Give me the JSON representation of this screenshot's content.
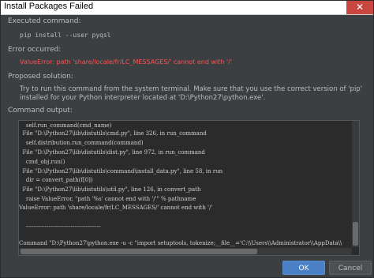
{
  "window": {
    "title": "Install Packages Failed",
    "close_glyph": "✕"
  },
  "executed": {
    "label": "Executed command:",
    "command": "pip install --user pyqsl"
  },
  "error": {
    "label": "Error occurred:",
    "message": "ValueError: path 'share/locale/fr/LC_MESSAGES/' cannot end with '/'"
  },
  "solution": {
    "label": "Proposed solution:",
    "text": "Try to run this command from the system terminal. Make sure that you use the correct version of 'pip' installed for your Python interpreter located at 'D:\\Python27\\python.exe'."
  },
  "output": {
    "label": "Command output:",
    "lines": [
      "    self.run_command(cmd_name)",
      "  File \"D:\\Python27\\lib\\distutils\\cmd.py\", line 326, in run_command",
      "    self.distribution.run_command(command)",
      "  File \"D:\\Python27\\lib\\distutils\\dist.py\", line 972, in run_command",
      "    cmd_obj.run()",
      "  File \"D:\\Python27\\lib\\distutils\\command\\install_data.py\", line 58, in run",
      "    dir = convert_path(f[0])",
      "  File \"D:\\Python27\\lib\\distutils\\util.py\", line 126, in convert_path",
      "    raise ValueError, \"path '%s' cannot end with '/'\" % pathname",
      "ValueError: path 'share/locale/fr/LC_MESSAGES/' cannot end with '/'",
      "",
      "    ----------------------------------------",
      "",
      "",
      "Command \"D:\\Python27\\python.exe -u -c \"import setuptools, tokenize;__file__='C:\\\\Users\\\\Administrator\\\\AppData\\\\"
    ]
  },
  "buttons": {
    "ok": "OK",
    "cancel": "Cancel"
  }
}
